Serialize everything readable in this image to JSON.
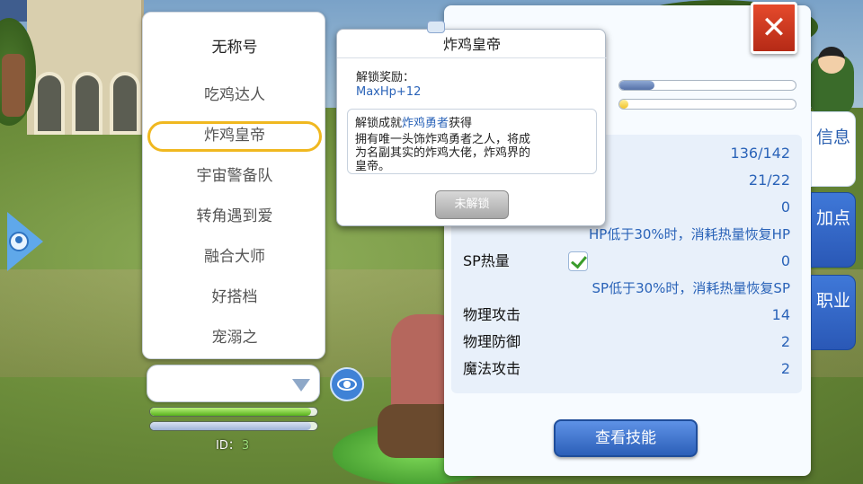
{
  "title_panel": {
    "heading": "无称号",
    "items": [
      {
        "label": "吃鸡达人"
      },
      {
        "label": "炸鸡皇帝"
      },
      {
        "label": "宇宙警备队"
      },
      {
        "label": "转角遇到爱"
      },
      {
        "label": "融合大师"
      },
      {
        "label": "好搭档"
      },
      {
        "label": "宠溺之"
      }
    ],
    "selected_index": 1
  },
  "tooltip": {
    "title": "炸鸡皇帝",
    "reward_label": "解锁奖励：",
    "reward_value": "MaxHp+12",
    "condition_prefix": "解锁成就",
    "condition_achievement": "炸鸡勇者",
    "condition_suffix": "获得",
    "description": "拥有唯一头饰炸鸡勇者之人，将成为名副其实的炸鸡大佬，炸鸡界的皇帝。",
    "status_button": "未解锁"
  },
  "player": {
    "id_label": "ID：",
    "id_value": "3",
    "hp_fraction": 0.96,
    "sp_fraction": 0.96
  },
  "stats": {
    "bar_a_fraction": 0.2,
    "bar_b_fraction": 0.05,
    "rows": [
      {
        "label": "",
        "value": "136/142"
      },
      {
        "label": "",
        "value": "21/22"
      },
      {
        "label": "",
        "value": "0"
      },
      {
        "note": "HP低于30%时，消耗热量恢复HP"
      },
      {
        "label": "SP热量",
        "value": "0",
        "checked": true
      },
      {
        "note": "SP低于30%时，消耗热量恢复SP"
      },
      {
        "label": "物理攻击",
        "value": "14"
      },
      {
        "label": "物理防御",
        "value": "2"
      },
      {
        "label": "魔法攻击",
        "value": "2"
      }
    ],
    "skills_button": "查看技能"
  },
  "side_tabs": [
    {
      "label": "信息",
      "active": true
    },
    {
      "label": "加点",
      "active": false
    },
    {
      "label": "职业",
      "active": false
    }
  ],
  "close_button": "✕",
  "colors": {
    "accent_blue": "#2a63b8",
    "highlight_gold": "#f0b820",
    "close_red": "#d03a22"
  }
}
